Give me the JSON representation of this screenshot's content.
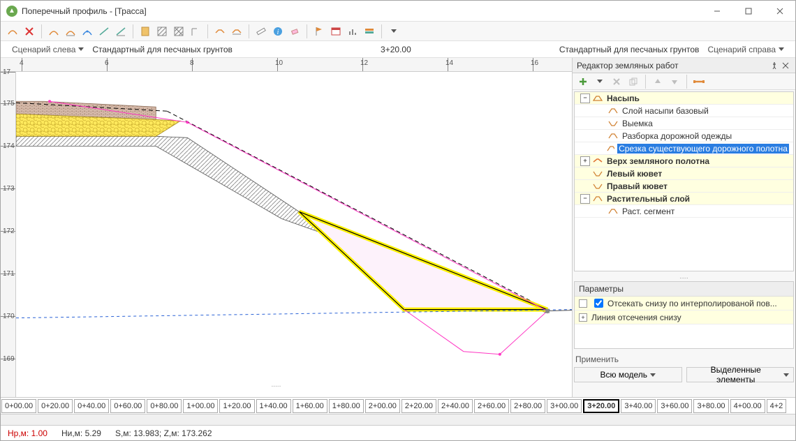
{
  "window": {
    "title": "Поперечный профиль - [Трасса]"
  },
  "scenario": {
    "left_label": "Сценарий слева",
    "left_value": "Стандартный для песчаных грунтов",
    "center": "3+20.00",
    "right_value": "Стандартный для песчаных грунтов",
    "right_label": "Сценарий справа"
  },
  "ruler_h": [
    "4",
    "6",
    "8",
    "10",
    "12",
    "14",
    "16"
  ],
  "ruler_v": [
    "17",
    "175",
    "174",
    "173",
    "172",
    "171",
    "170",
    "169"
  ],
  "side": {
    "title": "Редактор земляных работ",
    "tree": {
      "n1": "Насыпь",
      "n1a": "Слой насыпи базовый",
      "n1b": "Выемка",
      "n1c": "Разборка дорожной одежды",
      "n1d": "Срезка существующего дорожного полотна",
      "n2": "Верх земляного полотна",
      "n3": "Левый кювет",
      "n4": "Правый кювет",
      "n5": "Растительный слой",
      "n5a": "Раст. сегмент"
    },
    "params": {
      "title": "Параметры",
      "p1": "Отсекать снизу по интерполированой пов...",
      "p2": "Линия отсечения снизу"
    },
    "apply": {
      "title": "Применить",
      "btn1": "Всю модель",
      "btn2": "Выделенные элементы"
    }
  },
  "stations": [
    "0+00.00",
    "0+20.00",
    "0+40.00",
    "0+60.00",
    "0+80.00",
    "1+00.00",
    "1+20.00",
    "1+40.00",
    "1+60.00",
    "1+80.00",
    "2+00.00",
    "2+20.00",
    "2+40.00",
    "2+60.00",
    "2+80.00",
    "3+00.00",
    "3+20.00",
    "3+40.00",
    "3+60.00",
    "3+80.00",
    "4+00.00",
    "4+2"
  ],
  "status": {
    "hp": "Нр,м: 1.00",
    "hi": "Ни,м: 5.29",
    "sz": "S,м: 13.983;  Z,м: 173.262"
  },
  "colors": {
    "pavement_fill": "#d4b8a8",
    "base_fill": "#ffe95c",
    "cut_fill": "#fdf2fb",
    "highlight": "#fff200",
    "selection": "#2a7de1",
    "magenta": "#ff36c3"
  }
}
